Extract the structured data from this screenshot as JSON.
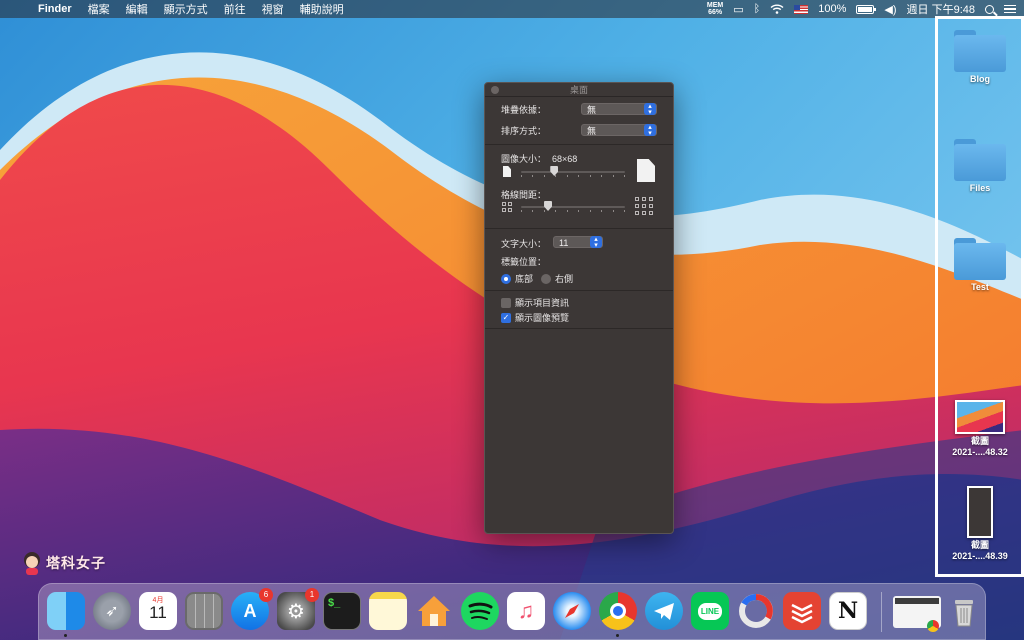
{
  "menubar": {
    "app_name": "Finder",
    "menus": [
      "檔案",
      "編輯",
      "顯示方式",
      "前往",
      "視窗",
      "輔助說明"
    ],
    "mem_label": "MEM",
    "mem_value": "66%",
    "battery_percent": "100%",
    "battery_level": 1.0,
    "clock": "週日 下午9:48"
  },
  "desktop": {
    "items": [
      {
        "label": "Blog",
        "kind": "folder"
      },
      {
        "label": "Files",
        "kind": "folder"
      },
      {
        "label": "Test",
        "kind": "folder"
      },
      {
        "label_line1": "截圖",
        "label_line2": "2021-....48.32",
        "kind": "screenshot"
      },
      {
        "label_line1": "截圖",
        "label_line2": "2021-....48.39",
        "kind": "screenshot"
      }
    ]
  },
  "panel": {
    "title": "桌面",
    "stack_by_label": "堆疊依據：",
    "stack_by_value": "無",
    "sort_by_label": "排序方式：",
    "sort_by_value": "無",
    "icon_size_label": "圖像大小：",
    "icon_size_value": "68×68",
    "icon_size_level": 0.32,
    "grid_spacing_label": "格線間距：",
    "grid_spacing_level": 0.26,
    "text_size_label": "文字大小：",
    "text_size_value": "11",
    "label_position_label": "標籤位置：",
    "label_position_options": [
      "底部",
      "右側"
    ],
    "label_position_selected": "底部",
    "show_item_info_label": "顯示項目資訊",
    "show_item_info_checked": false,
    "show_icon_preview_label": "顯示圖像預覽",
    "show_icon_preview_checked": true
  },
  "watermark": {
    "text": "塔科女子"
  },
  "dock": {
    "apps": [
      {
        "name": "finder-icon",
        "running": true
      },
      {
        "name": "launchpad-icon",
        "running": false
      },
      {
        "name": "calendar-icon",
        "month": "4月",
        "day": "11",
        "running": false
      },
      {
        "name": "calculator-icon",
        "running": false
      },
      {
        "name": "app-store-icon",
        "badge": "6",
        "running": false
      },
      {
        "name": "system-preferences-icon",
        "badge": "1",
        "running": false
      },
      {
        "name": "terminal-icon",
        "glyph": "$_",
        "running": false
      },
      {
        "name": "notes-icon",
        "running": false
      },
      {
        "name": "home-icon",
        "running": false
      },
      {
        "name": "spotify-icon",
        "running": false
      },
      {
        "name": "music-icon",
        "running": false
      },
      {
        "name": "safari-icon",
        "running": false
      },
      {
        "name": "chrome-icon",
        "running": true
      },
      {
        "name": "telegram-icon",
        "running": false
      },
      {
        "name": "line-icon",
        "glyph": "LINE",
        "running": false
      },
      {
        "name": "istat-icon",
        "running": false
      },
      {
        "name": "todoist-icon",
        "running": false
      },
      {
        "name": "notion-icon",
        "glyph": "N",
        "running": false
      },
      {
        "name": "recent-window-icon",
        "running": false
      },
      {
        "name": "trash-icon",
        "running": false
      }
    ]
  },
  "colors": {
    "accent": "#2f6fe0",
    "panel_bg": "#3c3736",
    "badge": "#e8362d"
  }
}
